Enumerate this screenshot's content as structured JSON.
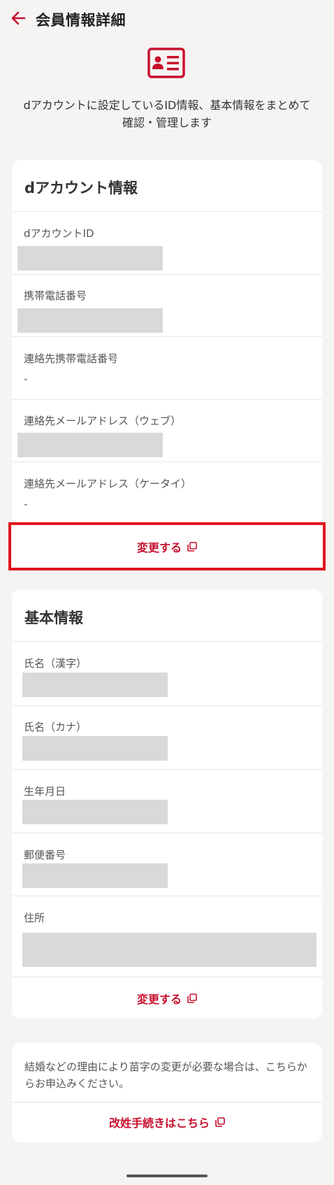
{
  "header": {
    "title": "会員情報詳細",
    "back_icon": "arrow-left-icon"
  },
  "intro": {
    "icon": "id-card-icon",
    "text": "dアカウントに設定しているID情報、基本情報をまとめて確認・管理します"
  },
  "account_card": {
    "title": "dアカウント情報",
    "fields": [
      {
        "label": "dアカウントID",
        "value": "",
        "masked": true
      },
      {
        "label": "携帯電話番号",
        "value": "",
        "masked": true
      },
      {
        "label": "連絡先携帯電話番号",
        "value": "-",
        "masked": false
      },
      {
        "label": "連絡先メールアドレス（ウェブ）",
        "value": "",
        "masked": true
      },
      {
        "label": "連絡先メールアドレス（ケータイ）",
        "value": "-",
        "masked": false
      }
    ],
    "change_label": "変更する"
  },
  "basic_card": {
    "title": "基本情報",
    "fields": [
      {
        "label": "氏名（漢字）",
        "masked": true
      },
      {
        "label": "氏名（カナ）",
        "masked": true
      },
      {
        "label": "生年月日",
        "masked": true
      },
      {
        "label": "郵便番号",
        "masked": true
      },
      {
        "label": "住所",
        "masked": true
      }
    ],
    "change_label": "変更する"
  },
  "note_card": {
    "text": "結婚などの理由により苗字の変更が必要な場合は、こちらからお申込みください。",
    "link_label": "改姓手続きはこちら"
  },
  "colors": {
    "accent": "#c8102e",
    "highlight": "#e1161f",
    "mask": "#d9d9d9",
    "background": "#f5f4f2"
  }
}
